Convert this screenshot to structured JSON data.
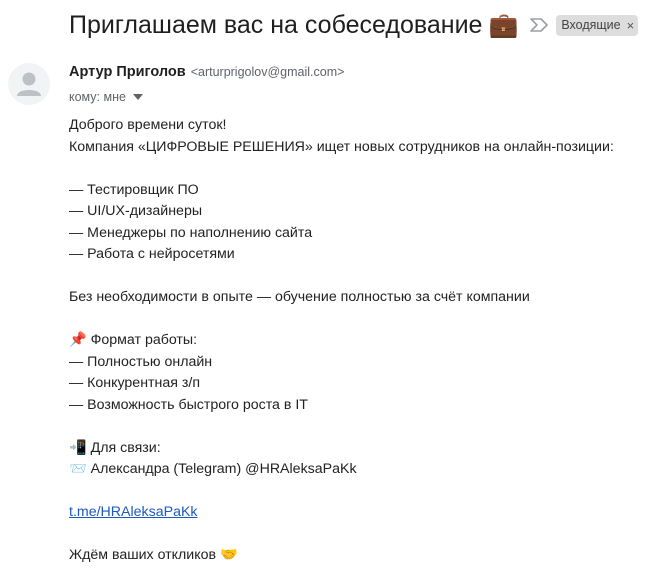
{
  "subject": {
    "text": "Приглашаем вас на собеседование",
    "emoji": "💼",
    "label": "Входящие",
    "label_close": "×",
    "importance_icon": "importance-marker-icon"
  },
  "sender": {
    "name": "Артур Приголов",
    "email": "<arturprigolov@gmail.com>",
    "avatar_icon": "person-avatar-icon"
  },
  "recipient": {
    "text": "кому: мне",
    "dropdown_icon": "caret-down-icon"
  },
  "body": {
    "greeting": "Доброго времени суток!",
    "intro": "Компания «ЦИФРОВЫЕ РЕШЕНИЯ» ищет новых сотрудников на онлайн-позиции:",
    "positions": [
      "— Тестировщик ПО",
      "— UI/UX-дизайнеры",
      "— Менеджеры по наполнению сайта",
      "— Работа с нейросетями"
    ],
    "experience": "Без необходимости в опыте — обучение полностью за счёт компании",
    "format_heading": "📌 Формат работы:",
    "format_items": [
      "— Полностью онлайн",
      "— Конкурентная з/п",
      "— Возможность быстрого роста в IT"
    ],
    "contact_heading": "📲 Для связи:",
    "contact_line": "📨 Александра (Telegram) @HRAleksaPaKk",
    "link": "t.me/HRAleksaPaKk",
    "closing": "Ждём ваших откликов 🤝"
  },
  "colors": {
    "link": "#1a59c3",
    "label_bg": "#dddddd",
    "muted": "#5f6368"
  }
}
